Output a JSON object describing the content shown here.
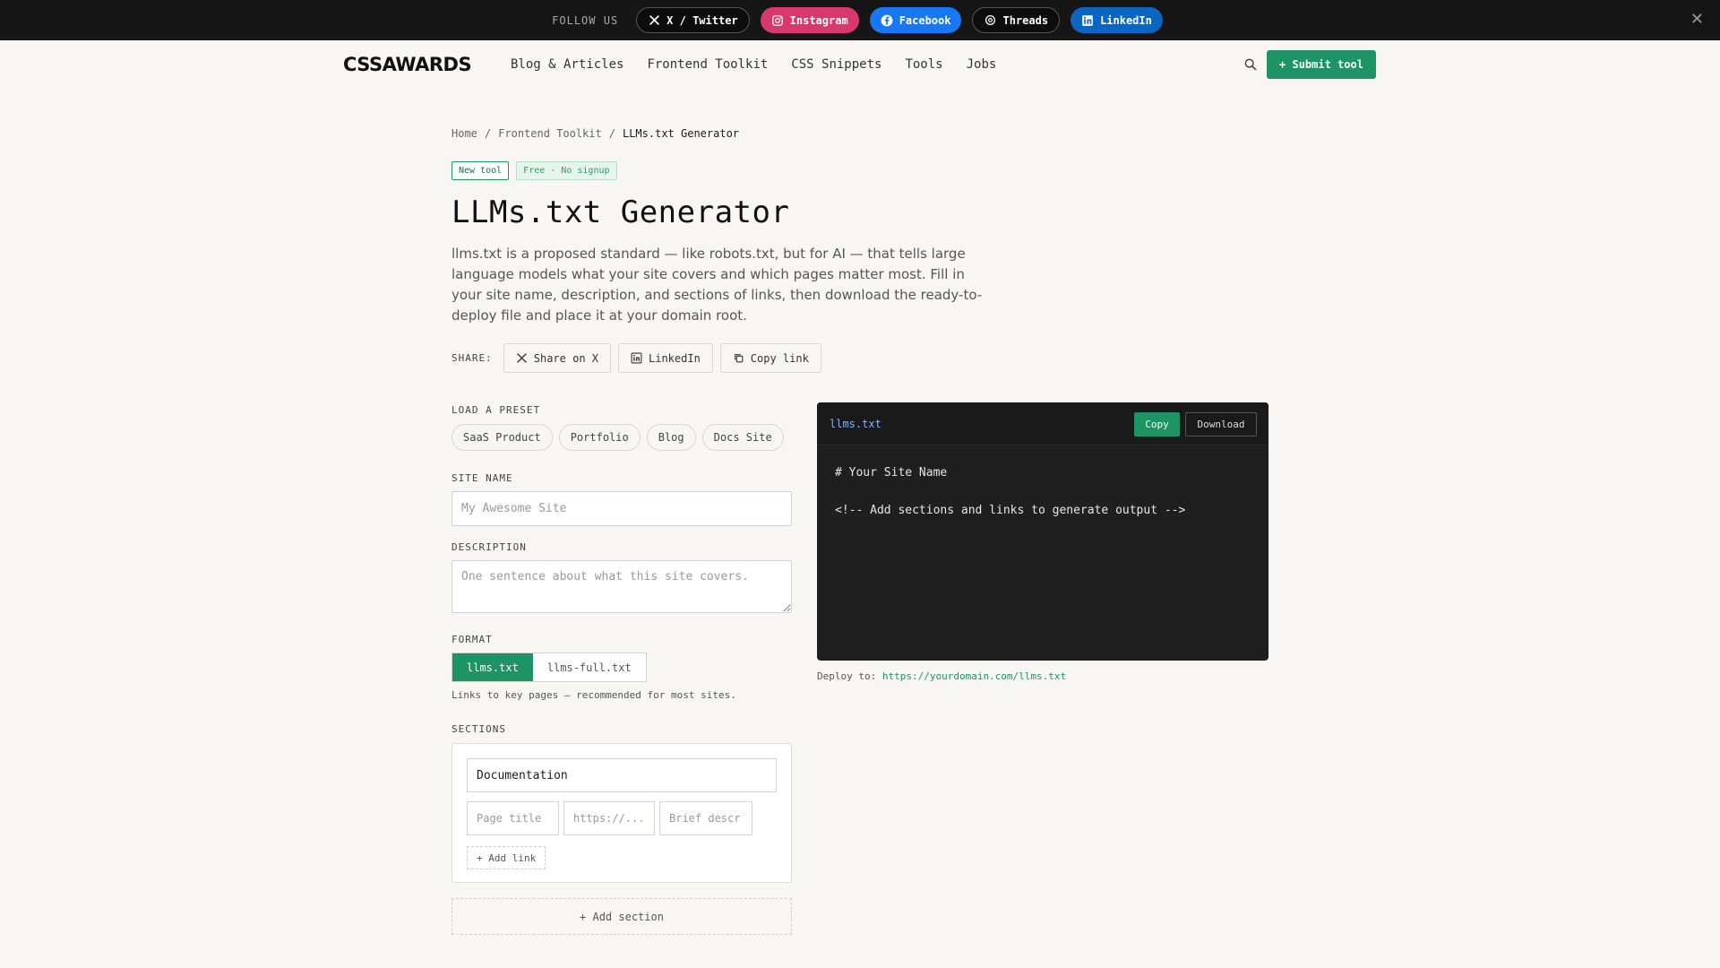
{
  "topbar": {
    "follow_label": "FOLLOW US",
    "social": [
      {
        "label": "X / Twitter",
        "icon": "x-icon"
      },
      {
        "label": "Instagram",
        "icon": "instagram-icon"
      },
      {
        "label": "Facebook",
        "icon": "facebook-icon"
      },
      {
        "label": "Threads",
        "icon": "threads-icon"
      },
      {
        "label": "LinkedIn",
        "icon": "linkedin-icon"
      }
    ],
    "close": "✕"
  },
  "nav": {
    "logo": "CSSAWARDS",
    "links": [
      "Blog & Articles",
      "Frontend Toolkit",
      "CSS Snippets",
      "Tools",
      "Jobs"
    ],
    "submit_label": "+ Submit tool"
  },
  "breadcrumb": [
    "Home",
    "/",
    "Frontend Toolkit",
    "/",
    "LLMs.txt Generator"
  ],
  "badges": {
    "new": "New tool",
    "free": "Free · No signup"
  },
  "title": "LLMs.txt Generator",
  "intro": "llms.txt is a proposed standard — like robots.txt, but for AI — that tells large language models what your site covers and which pages matter most. Fill in your site name, description, and sections of links, then download the ready-to-deploy file and place it at your domain root.",
  "share": {
    "label": "SHARE:",
    "buttons": [
      "Share on X",
      "LinkedIn",
      "Copy link"
    ]
  },
  "preset": {
    "label": "LOAD A PRESET",
    "options": [
      "SaaS Product",
      "Portfolio",
      "Blog",
      "Docs Site"
    ]
  },
  "site_name": {
    "label": "SITE NAME",
    "placeholder": "My Awesome Site",
    "value": ""
  },
  "description": {
    "label": "DESCRIPTION",
    "placeholder": "One sentence about what this site covers.",
    "value": ""
  },
  "format": {
    "label": "FORMAT",
    "options": [
      "llms.txt",
      "llms-full.txt"
    ],
    "selected": "llms.txt",
    "note": "Links to key pages — recommended for most sites."
  },
  "sections": {
    "label": "SECTIONS",
    "section_name": "Documentation",
    "link_placeholders": {
      "title": "Page title",
      "url": "https://...",
      "desc": "Brief descr"
    },
    "add_link": "+ Add link",
    "add_section": "+ Add section"
  },
  "output": {
    "filename": "llms.txt",
    "copy_label": "Copy",
    "download_label": "Download",
    "content": "# Your Site Name\n\n<!-- Add sections and links to generate output -->",
    "deploy_label": "Deploy to:",
    "deploy_url": "https://yourdomain.com/llms.txt"
  },
  "colors": {
    "accent": "#1e9466",
    "topbar": "#161616",
    "panel": "#1f1f1f",
    "background": "#f7f6f2"
  }
}
